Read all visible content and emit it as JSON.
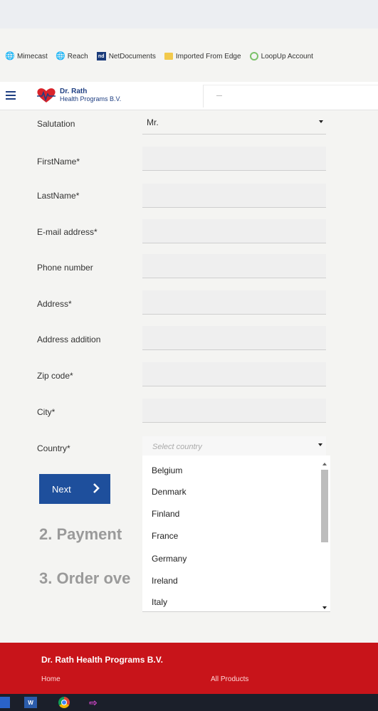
{
  "bookmarks": [
    {
      "label": "Mimecast",
      "icon": "globe-icon"
    },
    {
      "label": "Reach",
      "icon": "globe-icon"
    },
    {
      "label": "NetDocuments",
      "icon": "netdocuments-icon"
    },
    {
      "label": "Imported From Edge",
      "icon": "folder-icon"
    },
    {
      "label": "LoopUp Account",
      "icon": "loopup-icon"
    }
  ],
  "header": {
    "logo_line1": "Dr. Rath",
    "logo_line2": "Health Programs B.V."
  },
  "form": {
    "salutation": {
      "label": "Salutation",
      "value": "Mr."
    },
    "first_name": {
      "label": "FirstName*"
    },
    "last_name": {
      "label": "LastName*"
    },
    "email": {
      "label": "E-mail address*"
    },
    "phone": {
      "label": "Phone number"
    },
    "address": {
      "label": "Address*"
    },
    "address_addition": {
      "label": "Address addition"
    },
    "zip": {
      "label": "Zip code*"
    },
    "city": {
      "label": "City*"
    },
    "country": {
      "label": "Country*",
      "placeholder": "Select country"
    }
  },
  "country_options": [
    "Belgium",
    "Denmark",
    "Finland",
    "France",
    "Germany",
    "Ireland",
    "Italy"
  ],
  "next_label": "Next",
  "steps": {
    "payment": "2. Payment",
    "order": "3. Order ove"
  },
  "footer": {
    "brand": "Dr. Rath Health Programs B.V.",
    "link_home": "Home",
    "link_products": "All Products"
  },
  "colors": {
    "brand_blue": "#1e4f9c",
    "footer_red": "#c8141a"
  }
}
